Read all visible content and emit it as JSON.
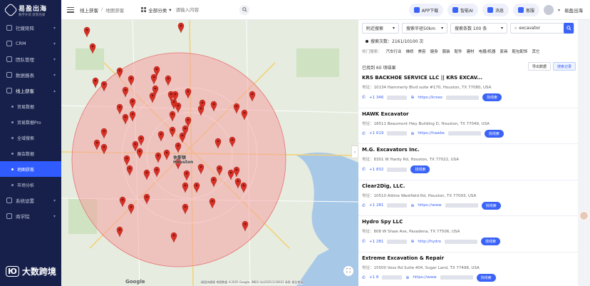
{
  "sidebar": {
    "logo_name": "易盈出海",
    "logo_sub": "数字外贸 获客先锋",
    "items": [
      {
        "label": "社媒矩阵",
        "type": "top",
        "icon": "share-icon"
      },
      {
        "label": "CRM",
        "type": "top",
        "icon": "crm-icon"
      },
      {
        "label": "团队管理",
        "type": "top",
        "icon": "team-icon"
      },
      {
        "label": "数据报表",
        "type": "top",
        "icon": "report-icon"
      },
      {
        "label": "线上获客",
        "type": "open",
        "icon": "acquire-icon"
      },
      {
        "label": "贸易数据",
        "type": "sub"
      },
      {
        "label": "贸易数据Pro",
        "type": "sub"
      },
      {
        "label": "全域搜索",
        "type": "sub"
      },
      {
        "label": "展会数据",
        "type": "sub"
      },
      {
        "label": "地图获客",
        "type": "active"
      },
      {
        "label": "市场分析",
        "type": "sub"
      },
      {
        "label": "系统设置",
        "type": "top",
        "icon": "settings-icon"
      },
      {
        "label": "商学院",
        "type": "top",
        "icon": "school-icon"
      }
    ]
  },
  "header": {
    "crumb_1": "线上获客",
    "crumb_sep": "/",
    "crumb_2": "地图获客",
    "category": "全部分类",
    "keyword_placeholder": "请输入内容",
    "app_download": "APP下载",
    "smart_ai": "智能AI",
    "messages": "消息",
    "support": "客服",
    "user": "易盈出海"
  },
  "map": {
    "city_label": "Houston",
    "city_label_cn": "休斯顿",
    "attribution": "键盘快捷键  地图数据 ©2025 Google, INEGI (b)2025/1/16023  条款  报告错误",
    "google": "Google"
  },
  "panel": {
    "filters": {
      "mode": "附近搜索",
      "radius": "搜索半径50km",
      "count": "搜索条数 100 条",
      "keyword": "excavator"
    },
    "search_count": "搜索次数：2161/10100 次",
    "hot_label": "热门搜索：",
    "hot_tags": [
      "汽车行业",
      "佛修",
      "美容",
      "健身",
      "服装",
      "配件",
      "建材",
      "电器/机器",
      "家具",
      "鞋包配饰",
      "其它"
    ],
    "found_text": "已找到 60 项结果",
    "export_label": "导出数据",
    "history_label": "搜索记录",
    "address_prefix": "地址：",
    "results": [
      {
        "name": "KRS BACKHOE SERVICE LLC || KRS EXCAV...",
        "address": "10134 Hammerly Blvd suite #170, Houston, TX 77080, USA",
        "phone": "+1 346",
        "web": "https://krsex",
        "btn": "找线索"
      },
      {
        "name": "HAWK Excavator",
        "address": "18511 Beaumont Hwy Building D, Houston, TX 77049, USA",
        "phone": "+1 619",
        "web": "https://hawke",
        "btn": "找线索"
      },
      {
        "name": "M.G. Excavators Inc.",
        "address": "8301 W Hardy Rd, Houston, TX 77022, USA",
        "phone": "+1 832",
        "web": "",
        "btn": "找线索"
      },
      {
        "name": "Clear2Dig, LLC.",
        "address": "10510 Aldine Westfield Rd, Houston, TX 77093, USA",
        "phone": "+1 281",
        "web": "https://www",
        "btn": "找线索"
      },
      {
        "name": "Hydro Spy LLC",
        "address": "808 W Shaw Ave, Pasadena, TX 77506, USA",
        "phone": "+1 281",
        "web": "http://hydro",
        "btn": "找线索"
      },
      {
        "name": "Extreme Excavation & Repair",
        "address": "15500 Voss Rd Suite 404, Sugar Land, TX 77498, USA",
        "phone": "+1 8",
        "web": "https://www",
        "btn": "找线索"
      }
    ]
  },
  "watermark": {
    "text": "大数跨境"
  },
  "colors": {
    "sidebar_bg": "#16204a",
    "accent": "#3b63f7",
    "marker": "#d93025",
    "radius_fill": "#f5a3a3"
  }
}
